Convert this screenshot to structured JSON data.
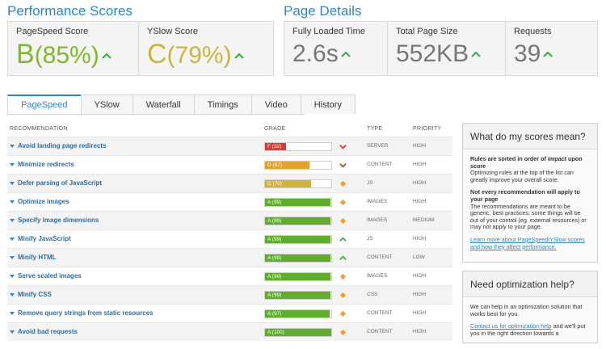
{
  "performance": {
    "title": "Performance Scores",
    "pagespeed": {
      "label": "PageSpeed Score",
      "letter": "B",
      "percent": "(85%)",
      "color": "#7cba2b"
    },
    "yslow": {
      "label": "YSlow Score",
      "letter": "C",
      "percent": "(79%)",
      "color": "#cbb53b"
    }
  },
  "details": {
    "title": "Page Details",
    "load": {
      "label": "Fully Loaded Time",
      "value": "2.6s"
    },
    "size": {
      "label": "Total Page Size",
      "value": "552KB"
    },
    "requests": {
      "label": "Requests",
      "value": "39"
    }
  },
  "tabs": [
    "PageSpeed",
    "YSlow",
    "Waterfall",
    "Timings",
    "Video",
    "History"
  ],
  "active_tab": "PageSpeed",
  "table": {
    "headers": {
      "recommendation": "RECOMMENDATION",
      "grade": "GRADE",
      "type": "TYPE",
      "priority": "PRIORITY"
    },
    "rows": [
      {
        "name": "Avoid landing page redirects",
        "grade": "F (32)",
        "score": 32,
        "color": "#d83c31",
        "indicator": "down",
        "type": "SERVER",
        "priority": "HIGH"
      },
      {
        "name": "Minimize redirects",
        "grade": "D (67)",
        "score": 67,
        "color": "#e6a02c",
        "indicator": "down",
        "type": "CONTENT",
        "priority": "HIGH"
      },
      {
        "name": "Defer parsing of JavaScript",
        "grade": "C (70)",
        "score": 70,
        "color": "#d1b23a",
        "indicator": "diamond",
        "type": "JS",
        "priority": "HIGH"
      },
      {
        "name": "Optimize images",
        "grade": "A (99)",
        "score": 99,
        "color": "#5fae2b",
        "indicator": "diamond",
        "type": "IMAGES",
        "priority": "HIGH"
      },
      {
        "name": "Specify image dimensions",
        "grade": "A (99)",
        "score": 99,
        "color": "#5fae2b",
        "indicator": "diamond",
        "type": "IMAGES",
        "priority": "MEDIUM"
      },
      {
        "name": "Minify JavaScript",
        "grade": "A (99)",
        "score": 99,
        "color": "#5fae2b",
        "indicator": "up",
        "type": "JS",
        "priority": "HIGH"
      },
      {
        "name": "Minify HTML",
        "grade": "A (99)",
        "score": 99,
        "color": "#5fae2b",
        "indicator": "up",
        "type": "CONTENT",
        "priority": "LOW"
      },
      {
        "name": "Serve scaled images",
        "grade": "A (99)",
        "score": 99,
        "color": "#5fae2b",
        "indicator": "diamond",
        "type": "IMAGES",
        "priority": "HIGH"
      },
      {
        "name": "Minify CSS",
        "grade": "A (99)",
        "score": 99,
        "color": "#5fae2b",
        "indicator": "diamond",
        "type": "CSS",
        "priority": "HIGH"
      },
      {
        "name": "Remove query strings from static resources",
        "grade": "A (97)",
        "score": 97,
        "color": "#5fae2b",
        "indicator": "diamond",
        "type": "CONTENT",
        "priority": "HIGH"
      },
      {
        "name": "Avoid bad requests",
        "grade": "A (100)",
        "score": 100,
        "color": "#5fae2b",
        "indicator": "diamond",
        "type": "CONTENT",
        "priority": "HIGH"
      }
    ]
  },
  "scores_panel": {
    "title": "What do my scores mean?",
    "heading1": "Rules are sorted in order of impact upon score",
    "text1": "Optimizing rules at the top of the list can greatly improve your overall score.",
    "heading2": "Not every recommendation will apply to your page",
    "text2": "The recommendations are meant to be generic, best practices; some things will be out of your control (eg. external resources) or may not apply to your page.",
    "link": "Learn more about PageSpeed/YSlow scores and how they affect performance."
  },
  "help_panel": {
    "title": "Need optimization help?",
    "text": "We can help in an optimization solution that works best for you.",
    "link": "Contact us for optimization help",
    "text_after": "and we'll put you in the right direction towards a"
  },
  "colors": {
    "accent": "#2c86c8",
    "up_arrow": "#3bb04a",
    "down_arrow": "#d83c31",
    "neutral": "#f0a030"
  }
}
